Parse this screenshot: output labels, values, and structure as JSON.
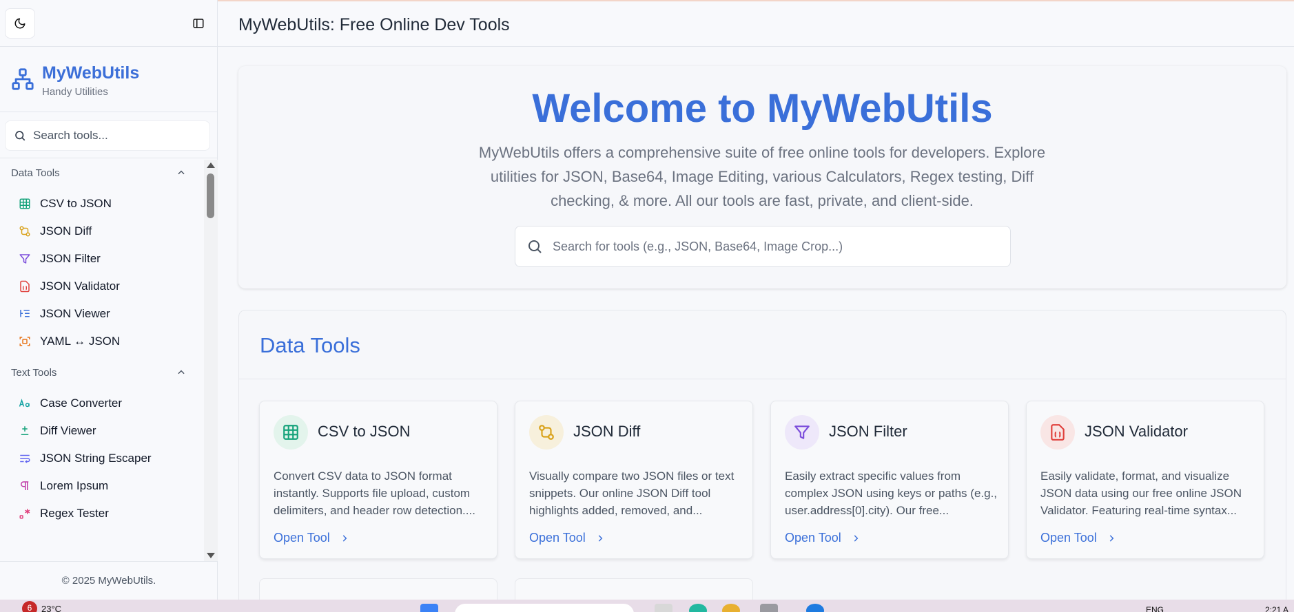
{
  "topbar": {
    "title": "MyWebUtils: Free Online Dev Tools"
  },
  "sidebar": {
    "brand_name": "MyWebUtils",
    "brand_tagline": "Handy Utilities",
    "search_placeholder": "Search tools...",
    "groups": [
      {
        "label": "Data Tools",
        "items": [
          {
            "label": "CSV to JSON",
            "icon": "table-icon",
            "color": "#16a37b"
          },
          {
            "label": "JSON Diff",
            "icon": "diff-icon",
            "color": "#d9a21b"
          },
          {
            "label": "JSON Filter",
            "icon": "filter-icon",
            "color": "#7c4ddb"
          },
          {
            "label": "JSON Validator",
            "icon": "file-json-icon",
            "color": "#e0403c"
          },
          {
            "label": "JSON Viewer",
            "icon": "list-tree-icon",
            "color": "#3a6fd9"
          },
          {
            "label": "YAML ↔ JSON",
            "icon": "convert-icon",
            "color": "#e8751a"
          }
        ]
      },
      {
        "label": "Text Tools",
        "items": [
          {
            "label": "Case Converter",
            "icon": "case-icon",
            "color": "#13a3a3"
          },
          {
            "label": "Diff Viewer",
            "icon": "plus-minus-icon",
            "color": "#16a37b"
          },
          {
            "label": "JSON String Escaper",
            "icon": "wrap-text-icon",
            "color": "#6366f1"
          },
          {
            "label": "Lorem Ipsum",
            "icon": "pilcrow-icon",
            "color": "#c03aa8"
          },
          {
            "label": "Regex Tester",
            "icon": "regex-icon",
            "color": "#e0407c"
          }
        ]
      }
    ],
    "footer": "© 2025 MyWebUtils."
  },
  "hero": {
    "title": "Welcome to MyWebUtils",
    "description": "MyWebUtils offers a comprehensive suite of free online tools for developers. Explore utilities for JSON, Base64, Image Editing, various Calculators, Regex testing, Diff checking, & more. All our tools are fast, private, and client-side.",
    "search_placeholder": "Search for tools (e.g., JSON, Base64, Image Crop...)"
  },
  "section": {
    "title": "Data Tools",
    "cards": [
      {
        "title": "CSV to JSON",
        "description": "Convert CSV data to JSON format instantly. Supports file upload, custom delimiters, and header row detection....",
        "link": "Open Tool",
        "icon": "table-icon",
        "color": "#16a37b",
        "bg": "#e3f4ec"
      },
      {
        "title": "JSON Diff",
        "description": "Visually compare two JSON files or text snippets. Our online JSON Diff tool highlights added, removed, and...",
        "link": "Open Tool",
        "icon": "diff-icon",
        "color": "#d9a21b",
        "bg": "#f7f0dc"
      },
      {
        "title": "JSON Filter",
        "description": "Easily extract specific values from complex JSON using keys or paths (e.g., user.address[0].city). Our free...",
        "link": "Open Tool",
        "icon": "filter-icon",
        "color": "#7c4ddb",
        "bg": "#eee8fa"
      },
      {
        "title": "JSON Validator",
        "description": "Easily validate, format, and visualize JSON data using our free online JSON Validator. Featuring real-time syntax...",
        "link": "Open Tool",
        "icon": "file-json-icon",
        "color": "#e0403c",
        "bg": "#f9e6e5"
      }
    ]
  },
  "taskbar": {
    "temp": "23°C",
    "weather_badge": "6",
    "lang": "ENG",
    "time": "2:21 A"
  }
}
